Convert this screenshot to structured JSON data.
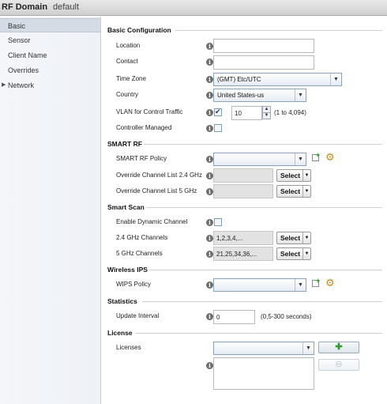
{
  "title": {
    "domain": "RF Domain",
    "name": "default"
  },
  "sidebar": {
    "items": [
      {
        "label": "Basic",
        "selected": true
      },
      {
        "label": "Sensor"
      },
      {
        "label": "Client Name"
      },
      {
        "label": "Overrides"
      },
      {
        "label": "Network",
        "expandable": true
      }
    ]
  },
  "basic": {
    "section": "Basic Configuration",
    "location": {
      "label": "Location",
      "value": ""
    },
    "contact": {
      "label": "Contact",
      "value": ""
    },
    "timezone": {
      "label": "Time Zone",
      "value": "(GMT) Etc/UTC"
    },
    "country": {
      "label": "Country",
      "value": "United States-us"
    },
    "vlan": {
      "label": "VLAN for Control Traffic",
      "checked": true,
      "value": "10",
      "range": "(1 to 4,094)"
    },
    "controller": {
      "label": "Controller Managed",
      "checked": false
    }
  },
  "smart_rf": {
    "section": "SMART RF",
    "policy": {
      "label": "SMART RF Policy",
      "value": ""
    },
    "override24": {
      "label": "Override Channel List 2.4 GHz",
      "button": "Select"
    },
    "override5": {
      "label": "Override Channel List 5 GHz",
      "button": "Select"
    }
  },
  "smart_scan": {
    "section": "Smart Scan",
    "dynamic": {
      "label": "Enable Dynamic Channel",
      "checked": false
    },
    "ch24": {
      "label": "2.4 GHz Channels",
      "value": "1,2,3,4,...",
      "button": "Select"
    },
    "ch5": {
      "label": "5 GHz Channels",
      "value": "21,25,34,36,...",
      "button": "Select"
    }
  },
  "wips": {
    "section": "Wireless IPS",
    "policy": {
      "label": "WIPS Policy",
      "value": ""
    }
  },
  "statistics": {
    "section": "Statistics",
    "interval": {
      "label": "Update Interval",
      "value": "0",
      "range": "(0,5-300 seconds)"
    }
  },
  "license": {
    "section": "License",
    "licenses": {
      "label": "Licenses",
      "value": ""
    },
    "add_glyph": "✚",
    "remove_glyph": "⊖"
  },
  "icons": {
    "info_glyph": "i",
    "dropdown_glyph": "▼",
    "spin_up": "▲",
    "spin_down": "▼",
    "network_arrow": "▶",
    "gear": "⚙",
    "plus": "+"
  },
  "colors": {
    "sidebar_selected": "#d5dbe5",
    "add_green": "#2c9a2c",
    "gear_orange": "#c98a1a"
  }
}
